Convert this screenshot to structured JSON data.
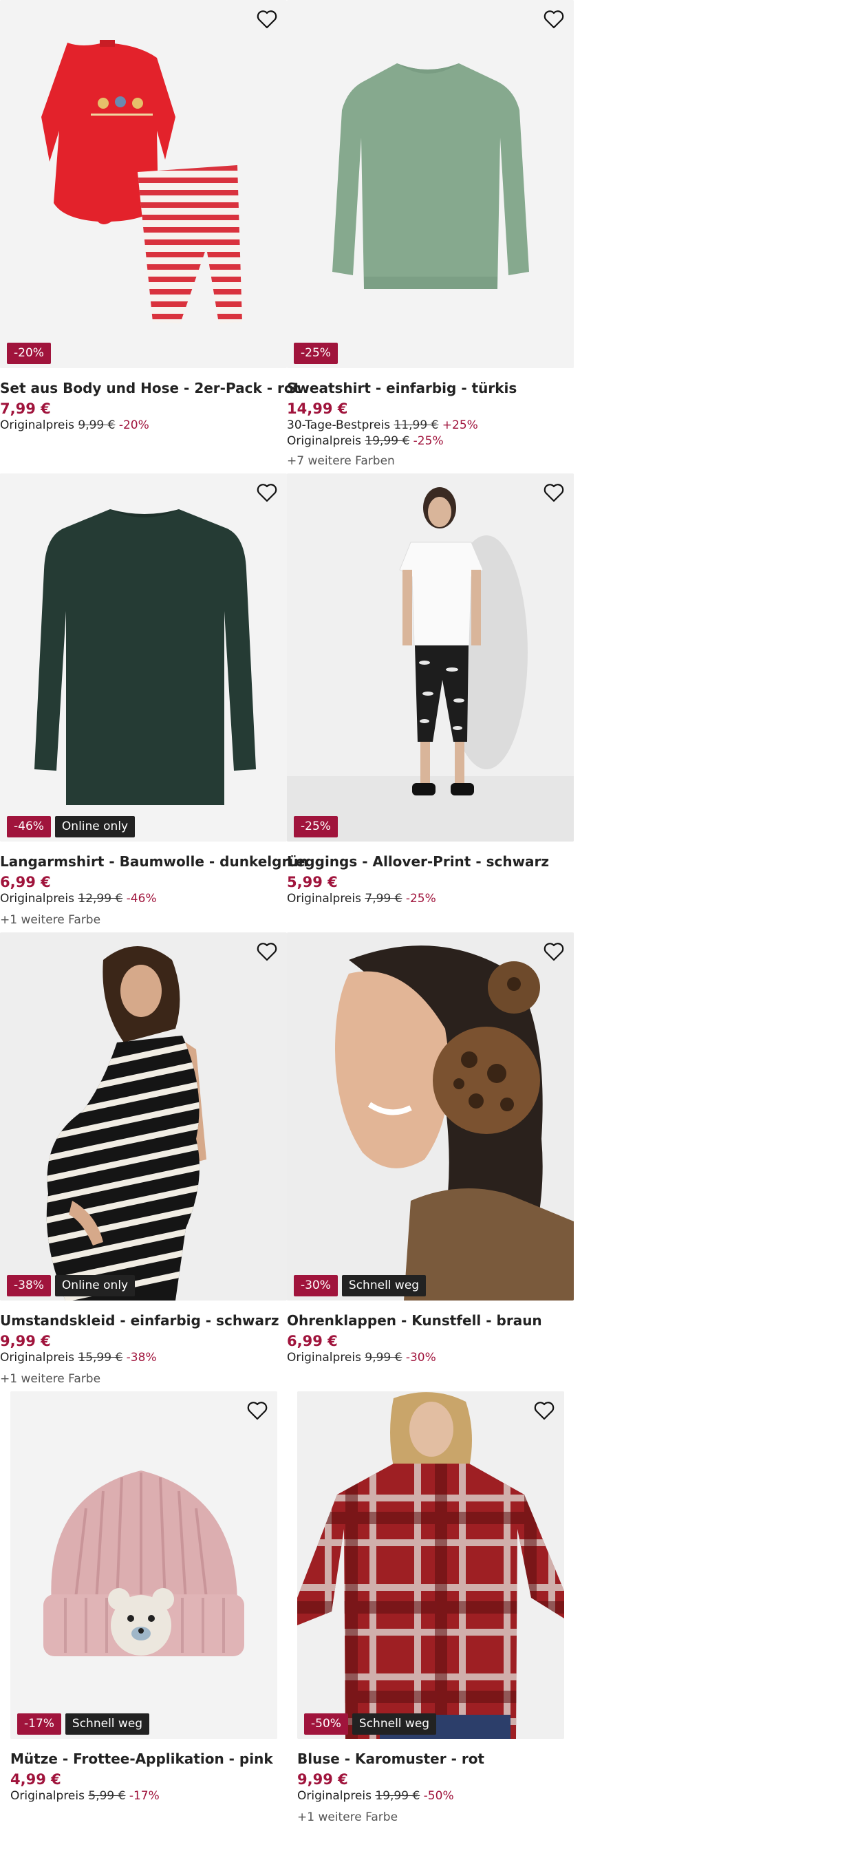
{
  "products": [
    {
      "title": "Set aus Body und Hose - 2er-Pack - rot",
      "price": "7,99 €",
      "original_label": "Originalpreis",
      "original_price": "9,99 €",
      "original_pct": "-20%",
      "badge_discount": "-20%",
      "wishlist_icon": "heart-outline-icon"
    },
    {
      "title": "Sweatshirt - einfarbig - türkis",
      "price": "14,99 €",
      "bestprice_label": "30-Tage-Bestpreis",
      "bestprice_price": "11,99 €",
      "bestprice_pct": "+25%",
      "original_label": "Originalpreis",
      "original_price": "19,99 €",
      "original_pct": "-25%",
      "more_colors": "+7 weitere Farben",
      "badge_discount": "-25%",
      "wishlist_icon": "heart-outline-icon"
    },
    {
      "title": "Langarmshirt - Baumwolle - dunkelgrün",
      "price": "6,99 €",
      "original_label": "Originalpreis",
      "original_price": "12,99 €",
      "original_pct": "-46%",
      "more_colors": "+1 weitere Farbe",
      "badge_discount": "-46%",
      "badge_tag": "Online only",
      "wishlist_icon": "heart-outline-icon"
    },
    {
      "title": "Leggings - Allover-Print - schwarz",
      "price": "5,99 €",
      "original_label": "Originalpreis",
      "original_price": "7,99 €",
      "original_pct": "-25%",
      "badge_discount": "-25%",
      "wishlist_icon": "heart-outline-icon"
    },
    {
      "title": "Umstandskleid - einfarbig - schwarz",
      "price": "9,99 €",
      "original_label": "Originalpreis",
      "original_price": "15,99 €",
      "original_pct": "-38%",
      "more_colors": "+1 weitere Farbe",
      "badge_discount": "-38%",
      "badge_tag": "Online only",
      "wishlist_icon": "heart-outline-icon"
    },
    {
      "title": "Ohrenklappen - Kunstfell - braun",
      "price": "6,99 €",
      "original_label": "Originalpreis",
      "original_price": "9,99 €",
      "original_pct": "-30%",
      "badge_discount": "-30%",
      "badge_tag": "Schnell weg",
      "wishlist_icon": "heart-outline-icon"
    },
    {
      "title": "Mütze - Frottee-Applikation - pink",
      "price": "4,99 €",
      "original_label": "Originalpreis",
      "original_price": "5,99 €",
      "original_pct": "-17%",
      "badge_discount": "-17%",
      "badge_tag": "Schnell weg",
      "wishlist_icon": "heart-outline-icon"
    },
    {
      "title": "Bluse - Karomuster - rot",
      "price": "9,99 €",
      "original_label": "Originalpreis",
      "original_price": "19,99 €",
      "original_pct": "-50%",
      "more_colors": "+1 weitere Farbe",
      "badge_discount": "-50%",
      "badge_tag": "Schnell weg",
      "wishlist_icon": "heart-outline-icon"
    }
  ],
  "colors": {
    "accent": "#a0143c",
    "tag_background": "#222222",
    "image_background": "#f3f3f3"
  }
}
